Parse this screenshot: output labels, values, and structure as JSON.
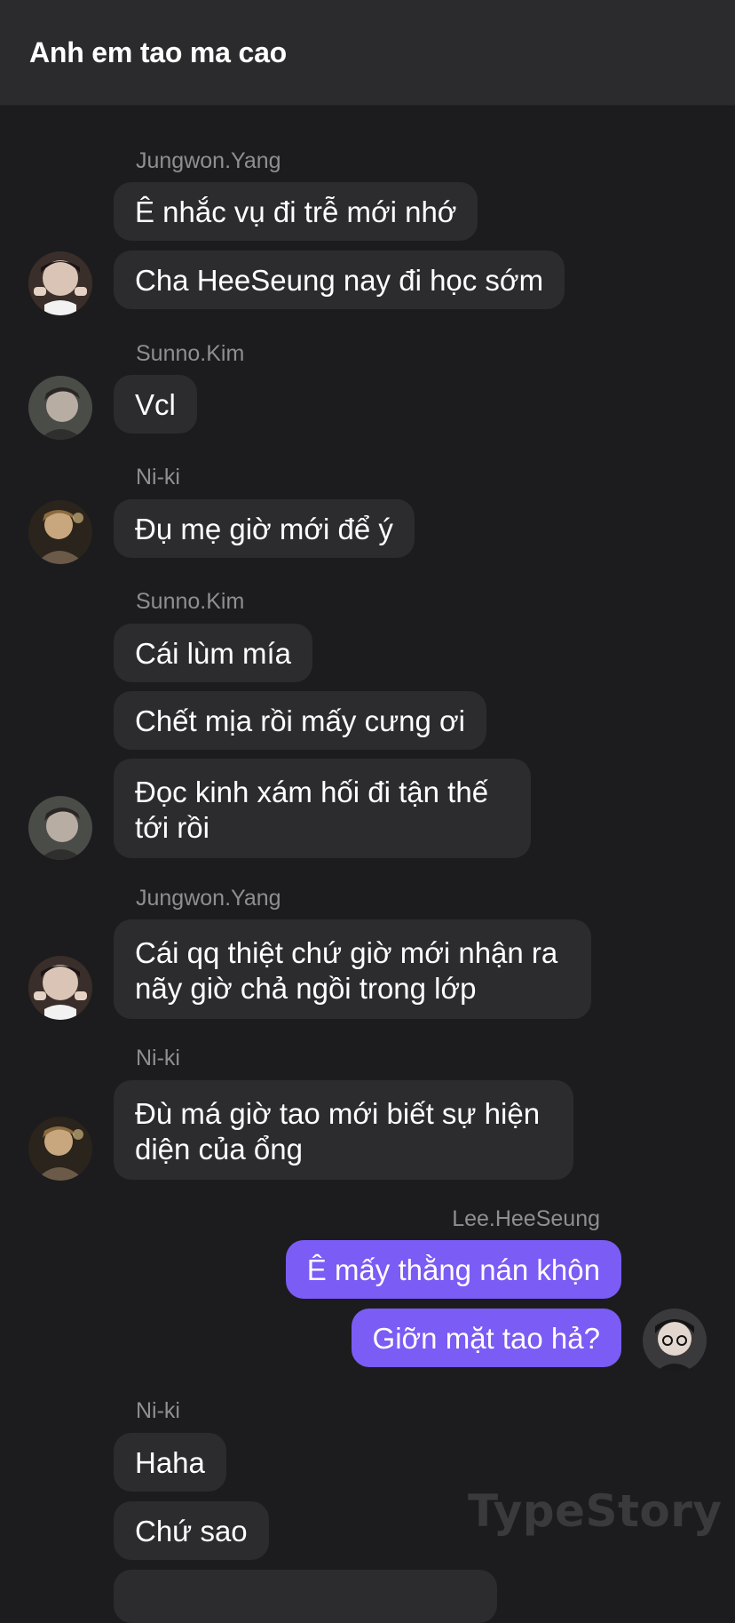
{
  "header": {
    "title": "Anh em tao ma cao"
  },
  "messages": [
    {
      "sender": "Jungwon.Yang",
      "lines": [
        "Ê nhắc vụ đi trễ mới nhớ",
        "Cha HeeSeung nay đi học sớm"
      ]
    },
    {
      "sender": "Sunno.Kim",
      "lines": [
        "Vcl"
      ]
    },
    {
      "sender": "Ni-ki",
      "lines": [
        "Đụ mẹ giờ mới để ý"
      ]
    },
    {
      "sender": "Sunno.Kim",
      "lines": [
        "Cái lùm mía",
        "Chết mịa rồi mấy cưng ơi",
        "Đọc kinh xám hối đi tận thế tới rồi"
      ]
    },
    {
      "sender": "Jungwon.Yang",
      "lines": [
        "Cái qq thiệt chứ giờ mới nhận ra nãy giờ chả ngồi trong lớp"
      ]
    },
    {
      "sender": "Ni-ki",
      "lines": [
        "Đù má giờ tao mới biết sự hiện diện của ổng"
      ]
    },
    {
      "sender": "Lee.HeeSeung",
      "lines": [
        "Ê mấy thằng nán khộn",
        "Giỡn mặt tao hả?"
      ]
    },
    {
      "sender": "Ni-ki",
      "lines": [
        "Haha",
        "Chứ sao"
      ]
    }
  ],
  "watermark": "TypeStory",
  "colors": {
    "outgoing": "#7b5cf5",
    "incoming": "#2c2c2e",
    "background": "#1c1c1e"
  }
}
